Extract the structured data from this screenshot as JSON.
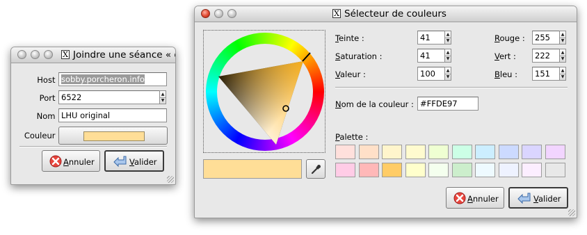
{
  "join_dialog": {
    "title": "Joindre une séance « o",
    "host_label": "Host :",
    "host_value": "sobby.porcheron.info",
    "port_label": "Port :",
    "port_value": "6522",
    "name_label": "Nom :",
    "name_value": "LHU original",
    "color_label": "Couleur :",
    "color_value": "#FFDE97",
    "cancel": {
      "first": "A",
      "rest": "nnuler"
    },
    "ok": {
      "first": "V",
      "rest": "alider"
    }
  },
  "color_dialog": {
    "title": "Sélecteur de couleurs",
    "hue": {
      "first": "T",
      "rest": "einte :",
      "value": "41"
    },
    "saturation": {
      "first": "S",
      "rest": "aturation :",
      "value": "41"
    },
    "val": {
      "first": "V",
      "rest": "aleur :",
      "value": "100"
    },
    "red": {
      "first": "R",
      "rest": "ouge :",
      "value": "255"
    },
    "green": {
      "first": "V",
      "rest": "ert :",
      "value": "222"
    },
    "blue": {
      "first": "B",
      "rest": "leu :",
      "value": "151"
    },
    "color_name": {
      "first": "N",
      "rest": "om de la couleur :",
      "value": "#FFDE97"
    },
    "palette": {
      "first": "P",
      "rest": "alette :"
    },
    "current_color": "#FFDE97",
    "palette_colors": [
      "#FFE0DC",
      "#FFE0C8",
      "#FFF5CC",
      "#FFFBCF",
      "#EFFFD2",
      "#CCFFE6",
      "#CCEEFF",
      "#CCDAFF",
      "#DAD5FF",
      "#F2D5FF",
      "#FFCCE6",
      "#FFB8B8",
      "#FFCC66",
      "#FFFFCC",
      "#F4FFEE",
      "#CCEECC",
      "#EEFAFF",
      "#EEF2FF",
      "#FCEEFF",
      "#E8E8E8"
    ],
    "cancel": {
      "first": "A",
      "rest": "nnuler"
    },
    "ok": {
      "first": "V",
      "rest": "alider"
    }
  }
}
